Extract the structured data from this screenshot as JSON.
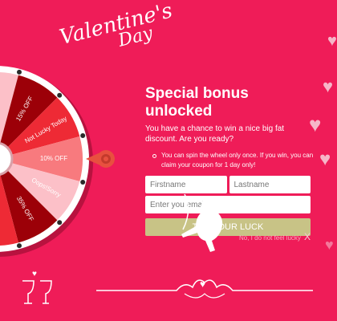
{
  "logo": {
    "line1": "Valentine's",
    "line2": "Day"
  },
  "wheel": {
    "segments": [
      {
        "label": "",
        "color": "#fcc0c8"
      },
      {
        "label": "15% OFF",
        "color": "#9c0008"
      },
      {
        "label": "Not Lucky Today",
        "color": "#ee2a35"
      },
      {
        "label": "10% OFF",
        "color": "#f87a7e"
      },
      {
        "label": "Oops!Sorry",
        "color": "#fcc0c8"
      },
      {
        "label": "35% OFF",
        "color": "#9c0008"
      },
      {
        "label": "",
        "color": "#ee2a35"
      }
    ],
    "pointer_color": "#e8503f"
  },
  "panel": {
    "title": "Special bonus unlocked",
    "description": "You have a chance to win a nice big fat discount. Are you ready?",
    "rule": "You can spin the wheel only once. If you win, you can claim your coupon for 1 day only!",
    "firstname_placeholder": "Firstname",
    "lastname_placeholder": "Lastname",
    "email_placeholder": "Enter you email",
    "submit_label": "TRY YOUR LUCK",
    "decline_label": "No, I do not feel lucky",
    "close_glyph": "X"
  }
}
